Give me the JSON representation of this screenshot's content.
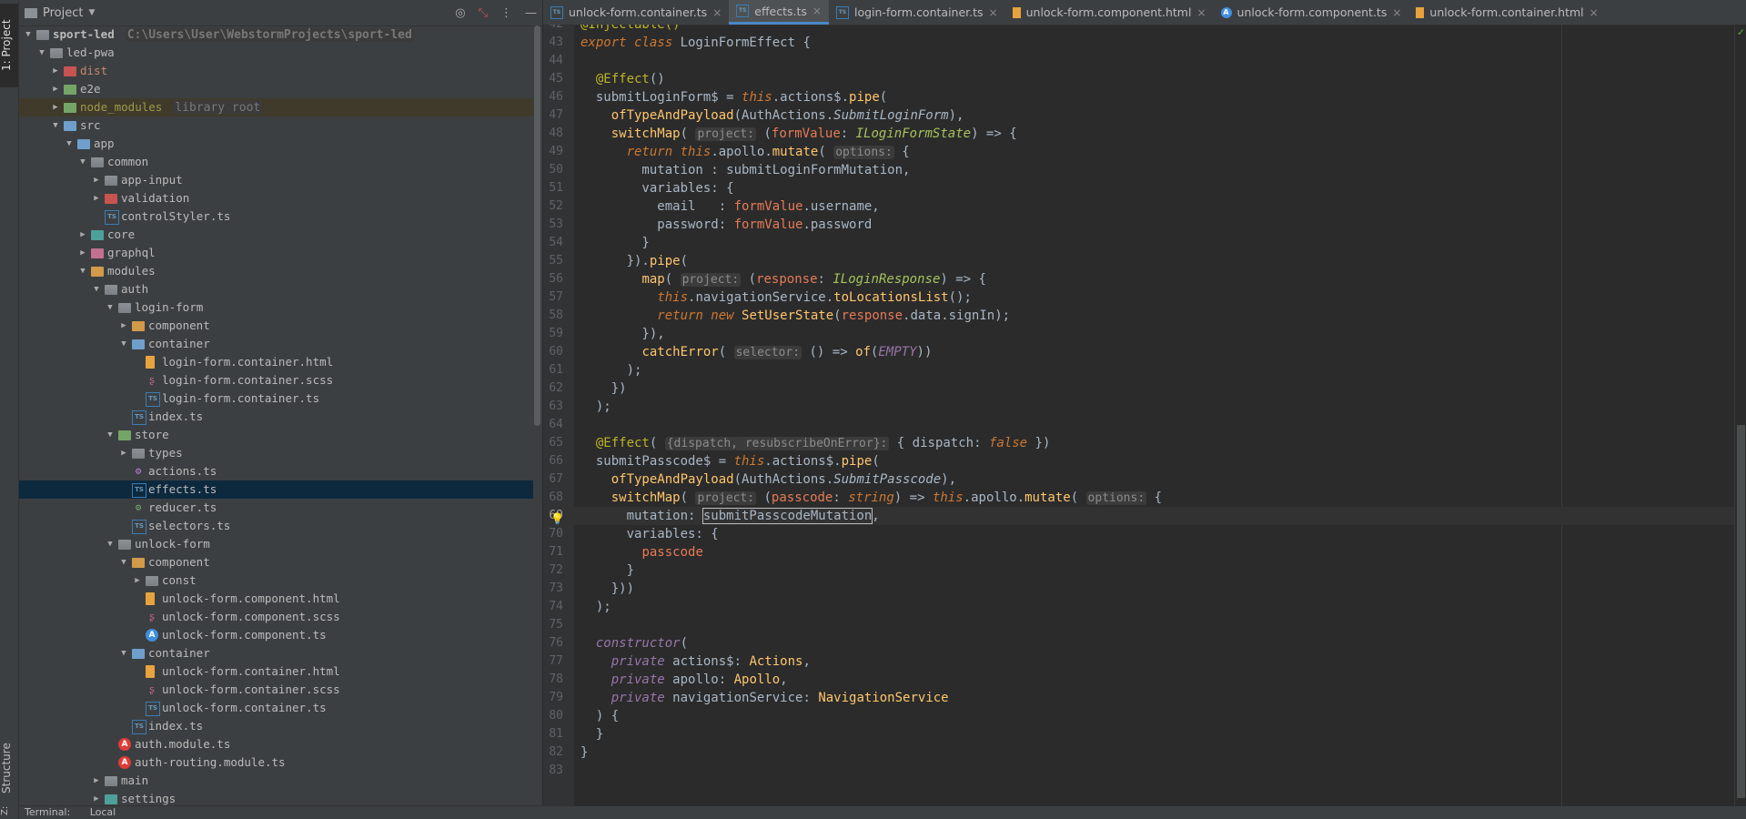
{
  "side_tabs": {
    "project": "1: Project",
    "structure": "Structure",
    "z": "Z:"
  },
  "project_panel": {
    "title": "Project",
    "tree": [
      {
        "depth": 0,
        "label": "sport-led",
        "hint": "C:\\Users\\User\\WebstormProjects\\sport-led",
        "icon": "folder",
        "expanded": true,
        "bold": true
      },
      {
        "depth": 1,
        "label": "led-pwa",
        "icon": "folder",
        "expanded": true
      },
      {
        "depth": 2,
        "label": "dist",
        "icon": "folder-red",
        "expanded": false,
        "tone": "red"
      },
      {
        "depth": 2,
        "label": "e2e",
        "icon": "folder-green",
        "expanded": false
      },
      {
        "depth": 2,
        "label": "node_modules",
        "hint": "library root",
        "icon": "folder-green",
        "expanded": false,
        "tone": "excluded",
        "rowtone": "excluded"
      },
      {
        "depth": 2,
        "label": "src",
        "icon": "folder-src",
        "expanded": true
      },
      {
        "depth": 3,
        "label": "app",
        "icon": "folder-src",
        "expanded": true
      },
      {
        "depth": 4,
        "label": "common",
        "icon": "folder",
        "expanded": true
      },
      {
        "depth": 5,
        "label": "app-input",
        "icon": "folder",
        "expanded": false
      },
      {
        "depth": 5,
        "label": "validation",
        "icon": "folder-red",
        "expanded": false
      },
      {
        "depth": 5,
        "label": "controlStyler.ts",
        "icon": "ts",
        "leaf": true
      },
      {
        "depth": 4,
        "label": "core",
        "icon": "folder-teal",
        "expanded": false
      },
      {
        "depth": 4,
        "label": "graphql",
        "icon": "folder-pink",
        "expanded": false
      },
      {
        "depth": 4,
        "label": "modules",
        "icon": "folder-orange",
        "expanded": true
      },
      {
        "depth": 5,
        "label": "auth",
        "icon": "folder",
        "expanded": true
      },
      {
        "depth": 6,
        "label": "login-form",
        "icon": "folder",
        "expanded": true
      },
      {
        "depth": 7,
        "label": "component",
        "icon": "folder-orange",
        "expanded": false
      },
      {
        "depth": 7,
        "label": "container",
        "icon": "folder-src",
        "expanded": true
      },
      {
        "depth": 8,
        "label": "login-form.container.html",
        "icon": "html",
        "leaf": true
      },
      {
        "depth": 8,
        "label": "login-form.container.scss",
        "icon": "scss",
        "leaf": true
      },
      {
        "depth": 8,
        "label": "login-form.container.ts",
        "icon": "ts",
        "leaf": true
      },
      {
        "depth": 7,
        "label": "index.ts",
        "icon": "ts",
        "leaf": true
      },
      {
        "depth": 6,
        "label": "store",
        "icon": "folder-green",
        "expanded": true
      },
      {
        "depth": 7,
        "label": "types",
        "icon": "folder",
        "expanded": false
      },
      {
        "depth": 7,
        "label": "actions.ts",
        "icon": "ngrx",
        "leaf": true
      },
      {
        "depth": 7,
        "label": "effects.ts",
        "icon": "ts",
        "leaf": true,
        "selected": true
      },
      {
        "depth": 7,
        "label": "reducer.ts",
        "icon": "store",
        "leaf": true
      },
      {
        "depth": 7,
        "label": "selectors.ts",
        "icon": "ts",
        "leaf": true
      },
      {
        "depth": 6,
        "label": "unlock-form",
        "icon": "folder",
        "expanded": true
      },
      {
        "depth": 7,
        "label": "component",
        "icon": "folder-orange",
        "expanded": true
      },
      {
        "depth": 8,
        "label": "const",
        "icon": "folder",
        "expanded": false
      },
      {
        "depth": 8,
        "label": "unlock-form.component.html",
        "icon": "html",
        "leaf": true
      },
      {
        "depth": 8,
        "label": "unlock-form.component.scss",
        "icon": "scss",
        "leaf": true
      },
      {
        "depth": 8,
        "label": "unlock-form.component.ts",
        "icon": "ngblue",
        "leaf": true
      },
      {
        "depth": 7,
        "label": "container",
        "icon": "folder-src",
        "expanded": true
      },
      {
        "depth": 8,
        "label": "unlock-form.container.html",
        "icon": "html",
        "leaf": true
      },
      {
        "depth": 8,
        "label": "unlock-form.container.scss",
        "icon": "scss",
        "leaf": true
      },
      {
        "depth": 8,
        "label": "unlock-form.container.ts",
        "icon": "ts",
        "leaf": true
      },
      {
        "depth": 7,
        "label": "index.ts",
        "icon": "ts",
        "leaf": true
      },
      {
        "depth": 6,
        "label": "auth.module.ts",
        "icon": "ng",
        "leaf": true
      },
      {
        "depth": 6,
        "label": "auth-routing.module.ts",
        "icon": "ng",
        "leaf": true
      },
      {
        "depth": 5,
        "label": "main",
        "icon": "folder",
        "expanded": false
      },
      {
        "depth": 5,
        "label": "settings",
        "icon": "folder-teal",
        "expanded": false
      }
    ]
  },
  "bottom_bar": {
    "terminal": "Terminal:",
    "local": "Local"
  },
  "tabs": [
    {
      "label": "unlock-form.container.ts",
      "icon": "ts",
      "active": false
    },
    {
      "label": "effects.ts",
      "icon": "ts",
      "active": true
    },
    {
      "label": "login-form.container.ts",
      "icon": "ts",
      "active": false
    },
    {
      "label": "unlock-form.component.html",
      "icon": "html",
      "active": false
    },
    {
      "label": "unlock-form.component.ts",
      "icon": "ng",
      "active": false
    },
    {
      "label": "unlock-form.container.html",
      "icon": "html",
      "active": false
    }
  ],
  "editor": {
    "current_line": 69,
    "lines": [
      {
        "n": 42,
        "t": [
          [
            "dec",
            "@Injectable()"
          ]
        ]
      },
      {
        "n": 43,
        "t": [
          [
            "kwi",
            "export class "
          ],
          [
            "",
            "LoginFormEffect {"
          ]
        ]
      },
      {
        "n": 44,
        "t": []
      },
      {
        "n": 45,
        "t": [
          [
            "",
            "  "
          ],
          [
            "dec",
            "@Effect"
          ],
          [
            "",
            "()"
          ]
        ]
      },
      {
        "n": 46,
        "t": [
          [
            "",
            "  submitLoginForm$ = "
          ],
          [
            "this",
            "this"
          ],
          [
            "",
            ".actions$."
          ],
          [
            "fn",
            "pipe"
          ],
          [
            "",
            "("
          ]
        ]
      },
      {
        "n": 47,
        "t": [
          [
            "",
            "    "
          ],
          [
            "fn",
            "ofTypeAndPayload"
          ],
          [
            "",
            "(AuthActions."
          ],
          [
            "cls",
            "SubmitLoginForm"
          ],
          [
            "",
            "),"
          ]
        ]
      },
      {
        "n": 48,
        "t": [
          [
            "",
            "    "
          ],
          [
            "fn",
            "switchMap"
          ],
          [
            "",
            "( "
          ],
          [
            "hint",
            "project:"
          ],
          [
            "",
            " ("
          ],
          [
            "prm",
            "formValue"
          ],
          [
            "",
            ": "
          ],
          [
            "typ",
            "ILoginFormState"
          ],
          [
            "",
            ") => {"
          ]
        ]
      },
      {
        "n": 49,
        "t": [
          [
            "",
            "      "
          ],
          [
            "kwi",
            "return "
          ],
          [
            "this",
            "this"
          ],
          [
            "",
            ".apollo."
          ],
          [
            "fn",
            "mutate"
          ],
          [
            "",
            "( "
          ],
          [
            "hint",
            "options:"
          ],
          [
            "",
            " {"
          ]
        ]
      },
      {
        "n": 50,
        "t": [
          [
            "",
            "        mutation : submitLoginFormMutation,"
          ]
        ]
      },
      {
        "n": 51,
        "t": [
          [
            "",
            "        variables: {"
          ]
        ]
      },
      {
        "n": 52,
        "t": [
          [
            "",
            "          email   : "
          ],
          [
            "prm",
            "formValue"
          ],
          [
            "",
            ".username,"
          ]
        ]
      },
      {
        "n": 53,
        "t": [
          [
            "",
            "          password: "
          ],
          [
            "prm",
            "formValue"
          ],
          [
            "",
            ".password"
          ]
        ]
      },
      {
        "n": 54,
        "t": [
          [
            "",
            "        }"
          ]
        ]
      },
      {
        "n": 55,
        "t": [
          [
            "",
            "      })."
          ],
          [
            "fn",
            "pipe"
          ],
          [
            "",
            "("
          ]
        ]
      },
      {
        "n": 56,
        "t": [
          [
            "",
            "        "
          ],
          [
            "fn",
            "map"
          ],
          [
            "",
            "( "
          ],
          [
            "hint",
            "project:"
          ],
          [
            "",
            " ("
          ],
          [
            "prm",
            "response"
          ],
          [
            "",
            ": "
          ],
          [
            "typ",
            "ILoginResponse"
          ],
          [
            "",
            ") => {"
          ]
        ]
      },
      {
        "n": 57,
        "t": [
          [
            "",
            "          "
          ],
          [
            "this",
            "this"
          ],
          [
            "",
            ".navigationService."
          ],
          [
            "fn",
            "toLocationsList"
          ],
          [
            "",
            "();"
          ]
        ]
      },
      {
        "n": 58,
        "t": [
          [
            "",
            "          "
          ],
          [
            "kwi",
            "return new "
          ],
          [
            "fn",
            "SetUserState"
          ],
          [
            "",
            "("
          ],
          [
            "prm",
            "response"
          ],
          [
            "",
            ".data.signIn);"
          ]
        ]
      },
      {
        "n": 59,
        "t": [
          [
            "",
            "        }),"
          ]
        ]
      },
      {
        "n": 60,
        "t": [
          [
            "",
            "        "
          ],
          [
            "fn",
            "catchError"
          ],
          [
            "",
            "( "
          ],
          [
            "hint",
            "selector:"
          ],
          [
            "",
            " () => "
          ],
          [
            "fn",
            "of"
          ],
          [
            "",
            "("
          ],
          [
            "cst",
            "EMPTY"
          ],
          [
            "",
            "))"
          ]
        ]
      },
      {
        "n": 61,
        "t": [
          [
            "",
            "      );"
          ]
        ]
      },
      {
        "n": 62,
        "t": [
          [
            "",
            "    })"
          ]
        ]
      },
      {
        "n": 63,
        "t": [
          [
            "",
            "  );"
          ]
        ]
      },
      {
        "n": 64,
        "t": []
      },
      {
        "n": 65,
        "t": [
          [
            "",
            "  "
          ],
          [
            "dec",
            "@Effect"
          ],
          [
            "",
            "( "
          ],
          [
            "hint",
            "{dispatch, resubscribeOnError}:"
          ],
          [
            "",
            " { dispatch: "
          ],
          [
            "kwi",
            "false"
          ],
          [
            "",
            " })"
          ]
        ]
      },
      {
        "n": 66,
        "t": [
          [
            "",
            "  submitPasscode$ = "
          ],
          [
            "this",
            "this"
          ],
          [
            "",
            ".actions$."
          ],
          [
            "fn",
            "pipe"
          ],
          [
            "",
            "("
          ]
        ]
      },
      {
        "n": 67,
        "t": [
          [
            "",
            "    "
          ],
          [
            "fn",
            "ofTypeAndPayload"
          ],
          [
            "",
            "(AuthActions."
          ],
          [
            "cls",
            "SubmitPasscode"
          ],
          [
            "",
            "),"
          ]
        ]
      },
      {
        "n": 68,
        "t": [
          [
            "",
            "    "
          ],
          [
            "fn",
            "switchMap"
          ],
          [
            "",
            "( "
          ],
          [
            "hint",
            "project:"
          ],
          [
            "",
            " ("
          ],
          [
            "prm",
            "passcode"
          ],
          [
            "",
            ": "
          ],
          [
            "kwi",
            "string"
          ],
          [
            "",
            ") => "
          ],
          [
            "this",
            "this"
          ],
          [
            "",
            ".apollo."
          ],
          [
            "fn",
            "mutate"
          ],
          [
            "",
            "( "
          ],
          [
            "hint",
            "options:"
          ],
          [
            "",
            " {"
          ]
        ]
      },
      {
        "n": 69,
        "t": [
          [
            "",
            "      mutation: "
          ],
          [
            "boxed",
            "submitPasscodeMutation"
          ],
          [
            "",
            ","
          ]
        ]
      },
      {
        "n": 70,
        "t": [
          [
            "",
            "      variables: {"
          ]
        ]
      },
      {
        "n": 71,
        "t": [
          [
            "",
            "        "
          ],
          [
            "prm",
            "passcode"
          ]
        ]
      },
      {
        "n": 72,
        "t": [
          [
            "",
            "      }"
          ]
        ]
      },
      {
        "n": 73,
        "t": [
          [
            "",
            "    }))"
          ]
        ]
      },
      {
        "n": 74,
        "t": [
          [
            "",
            "  );"
          ]
        ]
      },
      {
        "n": 75,
        "t": []
      },
      {
        "n": 76,
        "t": [
          [
            "",
            "  "
          ],
          [
            "kwp",
            "constructor"
          ],
          [
            "",
            "("
          ]
        ]
      },
      {
        "n": 77,
        "t": [
          [
            "",
            "    "
          ],
          [
            "kwp",
            "private "
          ],
          [
            "",
            "actions$: "
          ],
          [
            "fn",
            "Actions"
          ],
          [
            "",
            ","
          ]
        ]
      },
      {
        "n": 78,
        "t": [
          [
            "",
            "    "
          ],
          [
            "kwp",
            "private "
          ],
          [
            "",
            "apollo: "
          ],
          [
            "fn",
            "Apollo"
          ],
          [
            "",
            ","
          ]
        ]
      },
      {
        "n": 79,
        "t": [
          [
            "",
            "    "
          ],
          [
            "kwp",
            "private "
          ],
          [
            "",
            "navigationService: "
          ],
          [
            "fn",
            "NavigationService"
          ]
        ]
      },
      {
        "n": 80,
        "t": [
          [
            "",
            "  ) {"
          ]
        ]
      },
      {
        "n": 81,
        "t": [
          [
            "",
            "  }"
          ]
        ]
      },
      {
        "n": 82,
        "t": [
          [
            "",
            "}"
          ]
        ]
      },
      {
        "n": 83,
        "t": []
      }
    ]
  },
  "colors": {
    "accent": "#4a88c7",
    "selection": "#0d293e",
    "background": "#2b2b2b",
    "panel": "#3c3f41"
  }
}
